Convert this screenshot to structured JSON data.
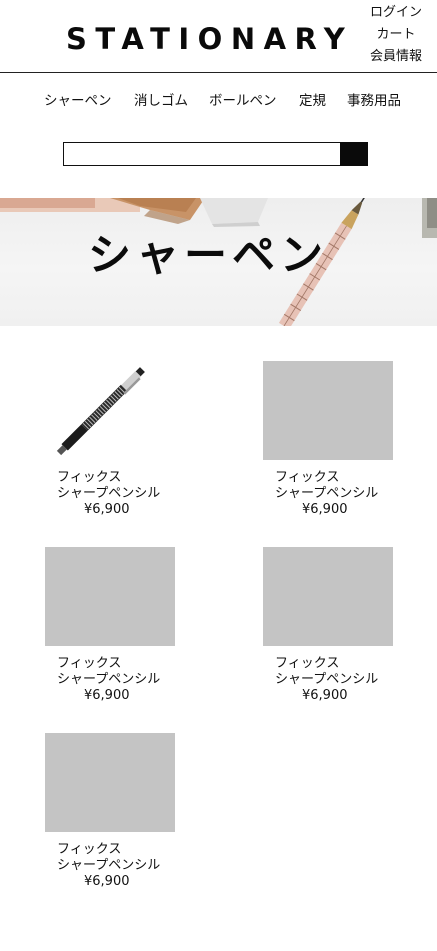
{
  "header": {
    "logo": "STATIONARY",
    "user_menu": [
      "ログイン",
      "カート",
      "会員情報"
    ]
  },
  "nav": {
    "items": [
      "シャーペン",
      "消しゴム",
      "ボールペン",
      "定規",
      "事務用品"
    ]
  },
  "search": {
    "value": "",
    "button_icon": "search-submit-block"
  },
  "hero": {
    "title": "シャーペン",
    "image": "pencil-on-desk-photo"
  },
  "products": [
    {
      "name_line1": "フィックス",
      "name_line2": "シャープペンシル",
      "price": "¥6,900",
      "image": "mechanical-pencil-photo"
    },
    {
      "name_line1": "フィックス",
      "name_line2": "シャープペンシル",
      "price": "¥6,900",
      "image": "placeholder"
    },
    {
      "name_line1": "フィックス",
      "name_line2": "シャープペンシル",
      "price": "¥6,900",
      "image": "placeholder"
    },
    {
      "name_line1": "フィックス",
      "name_line2": "シャープペンシル",
      "price": "¥6,900",
      "image": "placeholder"
    },
    {
      "name_line1": "フィックス",
      "name_line2": "シャープペンシル",
      "price": "¥6,900",
      "image": "placeholder"
    }
  ],
  "colors": {
    "placeholder": "#c4c4c4",
    "text": "#111111",
    "accent": "#0a0a0a"
  }
}
